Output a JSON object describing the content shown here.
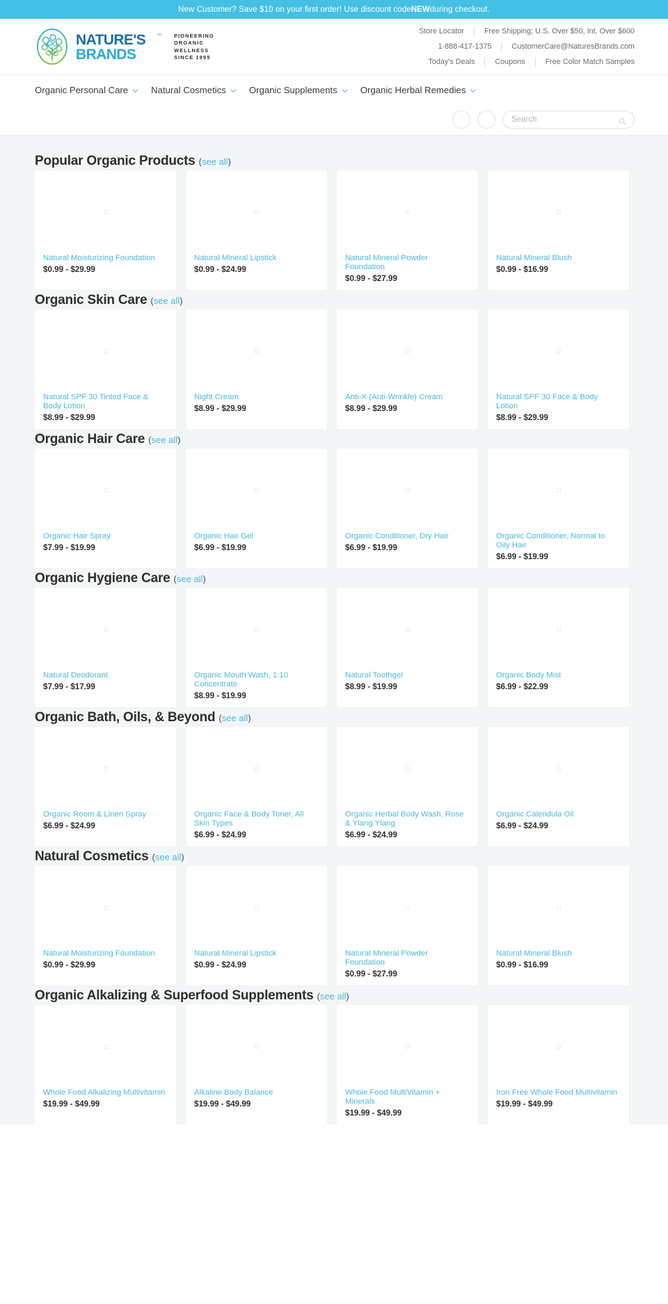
{
  "promo": {
    "text_before": "New Customer?  Save $10 on your first order!  Use discount code ",
    "code": "NEW",
    "text_after": " during checkout."
  },
  "header": {
    "logo_word_top": "NATURE'S",
    "logo_word_bottom": "BRANDS",
    "tagline_lines": [
      "PIONEERING",
      "ORGANIC",
      "WELLNESS",
      "SINCE 1995"
    ],
    "links_row1": [
      "Store Locator",
      "Free Shipping; U.S. Over $50, Int. Over $600"
    ],
    "links_row2": [
      "1-888-417-1375",
      "CustomerCare@NaturesBrands.com"
    ],
    "links_row3": [
      "Today's Deals",
      "Coupons",
      "Free Color Match Samples"
    ]
  },
  "nav": {
    "items": [
      "Organic Personal Care",
      "Natural Cosmetics",
      "Organic Supplements",
      "Organic Herbal Remedies"
    ]
  },
  "search": {
    "placeholder": "Search",
    "value": "",
    "icon": "search-icon"
  },
  "colors": {
    "promo_bg": "#44c0e4",
    "link_blue": "#4db8dd",
    "page_bg": "#f2f6f7",
    "card_bg": "#ffffff"
  },
  "see_all_label": "see all",
  "sections": [
    {
      "title": "Popular Organic Products",
      "products": [
        {
          "name": "Natural Moisturizing Foundation",
          "price": "$0.99 - $29.99"
        },
        {
          "name": "Natural Mineral Lipstick",
          "price": "$0.99 - $24.99"
        },
        {
          "name": "Natural Mineral Powder Foundation",
          "price": "$0.99 - $27.99"
        },
        {
          "name": "Natural Mineral Blush",
          "price": "$0.99 - $16.99"
        }
      ]
    },
    {
      "title": "Organic Skin Care",
      "products": [
        {
          "name": "Natural SPF 30 Tinted Face & Body Lotion",
          "price": "$8.99 - $29.99"
        },
        {
          "name": "Night Cream",
          "price": "$8.99 - $29.99"
        },
        {
          "name": "Anti-X (Anti-Wrinkle) Cream",
          "price": "$8.99 - $29.99"
        },
        {
          "name": "Natural SPF 30 Face & Body Lotion",
          "price": "$8.99 - $29.99"
        }
      ]
    },
    {
      "title": "Organic Hair Care",
      "products": [
        {
          "name": "Organic Hair Spray",
          "price": "$7.99 - $19.99"
        },
        {
          "name": "Organic Hair Gel",
          "price": "$6.99 - $19.99"
        },
        {
          "name": "Organic Conditioner, Dry Hair",
          "price": "$6.99 - $19.99"
        },
        {
          "name": "Organic Conditioner, Normal to Oily Hair",
          "price": "$6.99 - $19.99"
        }
      ]
    },
    {
      "title": "Organic Hygiene Care",
      "products": [
        {
          "name": "Natural Deodorant",
          "price": "$7.99 - $17.99"
        },
        {
          "name": "Organic Mouth Wash, 1:10 Concentrate",
          "price": "$8.99 - $19.99"
        },
        {
          "name": "Natural Toothgel",
          "price": "$8.99 - $19.99"
        },
        {
          "name": "Organic Body Mist",
          "price": "$6.99 - $22.99"
        }
      ]
    },
    {
      "title": "Organic Bath, Oils, & Beyond",
      "products": [
        {
          "name": "Organic Room & Linen Spray",
          "price": "$6.99 - $24.99"
        },
        {
          "name": "Organic Face & Body Toner, All Skin Types",
          "price": "$6.99 - $24.99"
        },
        {
          "name": "Organic Herbal Body Wash, Rose & Ylang Ylang",
          "price": "$6.99 - $24.99"
        },
        {
          "name": "Organic Calendula Oil",
          "price": "$6.99 - $24.99"
        }
      ]
    },
    {
      "title": "Natural Cosmetics",
      "products": [
        {
          "name": "Natural Moisturizing Foundation",
          "price": "$0.99 - $29.99"
        },
        {
          "name": "Natural Mineral Lipstick",
          "price": "$0.99 - $24.99"
        },
        {
          "name": "Natural Mineral Powder Foundation",
          "price": "$0.99 - $27.99"
        },
        {
          "name": "Natural Mineral Blush",
          "price": "$0.99 - $16.99"
        }
      ]
    },
    {
      "title": "Organic Alkalizing & Superfood Supplements",
      "products": [
        {
          "name": "Whole Food Alkalizing Multivitamin",
          "price": "$19.99 - $49.99"
        },
        {
          "name": "Alkaline Body Balance",
          "price": "$19.99 - $49.99"
        },
        {
          "name": "Whole Food MultiVitamin + Minerals",
          "price": "$19.99 - $49.99"
        },
        {
          "name": "Iron Free Whole Food Multivitamin",
          "price": "$19.99 - $49.99"
        }
      ]
    }
  ]
}
